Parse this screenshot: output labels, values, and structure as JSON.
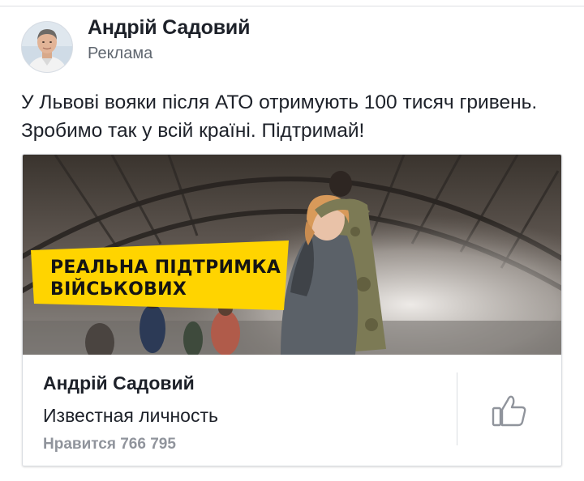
{
  "post": {
    "author": "Андрій Садовий",
    "sponsored_label": "Реклама",
    "text": "У Львові вояки після АТО отримують 100 тисяч гривень. Зробимо так у всій країні. Підтримай!"
  },
  "ad": {
    "banner_line1": "РЕАЛЬНА ПІДТРИМКА",
    "banner_line2": "ВІЙСЬКОВИХ",
    "banner_color": "#ffd400"
  },
  "page_card": {
    "name": "Андрій Садовий",
    "category": "Известная личность",
    "likes": "Нравится 766 795"
  },
  "icons": {
    "avatar": "profile-photo",
    "like": "thumbs-up-icon"
  },
  "colors": {
    "text": "#1d2129",
    "secondary": "#606770",
    "muted": "#90949c",
    "border": "#dadde1"
  }
}
